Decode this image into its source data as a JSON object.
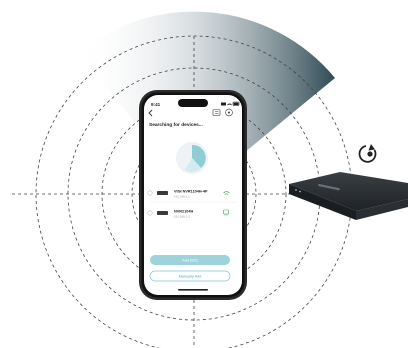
{
  "status_bar": {
    "time": "9:41"
  },
  "header": {
    "title": "Searching for devices..."
  },
  "devices": [
    {
      "name": "VIGI NVR1104H-4P",
      "ip": "192.168.1.1"
    },
    {
      "name": "NVR2104H",
      "ip": "192.168.1.2"
    }
  ],
  "buttons": {
    "add": "Add (0/2)",
    "manual": "Manually Add"
  },
  "colors": {
    "accent": "#7ec6d0",
    "radar": "#2f4a55",
    "device": "#2a2f33"
  },
  "icons": {
    "back": "chevron-left-icon",
    "list": "list-icon",
    "help": "help-icon",
    "refresh": "refresh-icon",
    "wifi": "wifi-icon",
    "ethernet": "ethernet-icon"
  }
}
